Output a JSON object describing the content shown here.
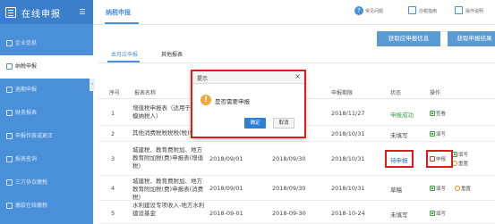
{
  "app": {
    "title": "在线申报"
  },
  "sidebar": {
    "items": [
      {
        "label": "企业信息",
        "active": false
      },
      {
        "label": "纳税申报",
        "active": true
      },
      {
        "label": "逾期申报",
        "active": false
      },
      {
        "label": "财务报表",
        "active": false
      },
      {
        "label": "申报作废或更正",
        "active": false
      },
      {
        "label": "报表查询",
        "active": false
      },
      {
        "label": "三方协议缴税",
        "active": false
      },
      {
        "label": "缴款在线缴税",
        "active": false
      }
    ]
  },
  "header": {
    "title": "纳税申报",
    "actions": [
      {
        "label": "常见问题",
        "icon": "help-icon"
      },
      {
        "label": "办税指南",
        "icon": "guide-icon"
      },
      {
        "label": "操作说明",
        "icon": "manual-icon"
      }
    ]
  },
  "toolbar": {
    "get_info_label": "获取应申报信息",
    "get_result_label": "获取申报结果"
  },
  "tabs": [
    {
      "label": "本月应申报",
      "active": true
    },
    {
      "label": "其他报表",
      "active": false
    }
  ],
  "table": {
    "columns": [
      "序号",
      "报表名称",
      "",
      "",
      "申报期限",
      "状态",
      "操作"
    ],
    "rows": [
      {
        "no": "1",
        "name": "增值税申报表（适用于小规模纳税人）",
        "start": "",
        "end": "",
        "deadline": "2018/11/27",
        "status": "申报成功",
        "status_color": "#3aa344",
        "ops": [
          "查看"
        ]
      },
      {
        "no": "2",
        "name": "其他消费税税税税(税)税",
        "start": "",
        "end": "",
        "deadline": "2018/10/31",
        "status": "未填写",
        "status_color": "#444444",
        "ops": [
          "填写"
        ]
      },
      {
        "no": "3",
        "name": "城建税、教育费附加、地方教育附加税(费)申报表(增值税)",
        "start": "2018/09/01",
        "end": "2018/09/30",
        "deadline": "2018/10/31",
        "status": "待申报",
        "status_color": "#2b6fc2",
        "ops": [
          "申报",
          "填写",
          "重置"
        ]
      },
      {
        "no": "4",
        "name": "城建税、教育费附加、地方教育附加税(费)申报表(消费税)",
        "start": "2018/09/01",
        "end": "2018/09/30",
        "deadline": "2018/10/31",
        "status": "草稿",
        "status_color": "#444444",
        "ops": [
          "填写",
          "重置"
        ]
      },
      {
        "no": "5",
        "name": "水利建设专项收入-地方水利建设基金",
        "start": "2018-09-01",
        "end": "2018-09-30",
        "deadline": "2018-10-24",
        "status": "未填写",
        "status_color": "#444444",
        "ops": [
          "填写"
        ]
      }
    ]
  },
  "dialog": {
    "title": "提示",
    "close": "×",
    "warning_glyph": "!",
    "message": "是否需要申报",
    "ok_label": "确定",
    "cancel_label": "取消"
  },
  "colors": {
    "sidebar": "#4a90d9",
    "accent": "#4a90d9",
    "highlight": "#e01b1b",
    "success": "#3aa344",
    "primary_button": "#5b9bd5"
  }
}
